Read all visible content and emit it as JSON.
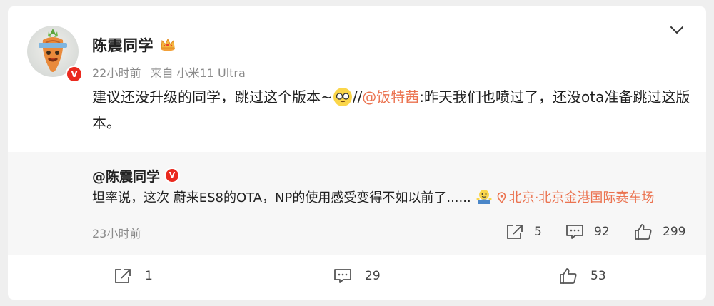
{
  "post": {
    "username": "陈震同学",
    "time": "22小时前",
    "source": "来自 小米11 Ultra",
    "text_part1": "建议还没升级的同学，跳过这个版本~",
    "text_part2": "//",
    "mention": "@饭特茜",
    "text_part3": ":昨天我们也喷过了，还没ota准备跳过这版本。"
  },
  "repost": {
    "username": "@陈震同学",
    "text": "坦率说，这次 蔚来ES8的OTA，NP的使用感受变得不如以前了......",
    "location": "北京·北京金港国际赛车场",
    "time": "23小时前",
    "shares": "5",
    "comments": "92",
    "likes": "299"
  },
  "footer": {
    "shares": "1",
    "comments": "29",
    "likes": "53"
  },
  "badge_label": "V",
  "colors": {
    "accent": "#eb7350",
    "verified": "#ea2a1f",
    "background": "#efefef",
    "repost_bg": "#f7f7f7"
  }
}
